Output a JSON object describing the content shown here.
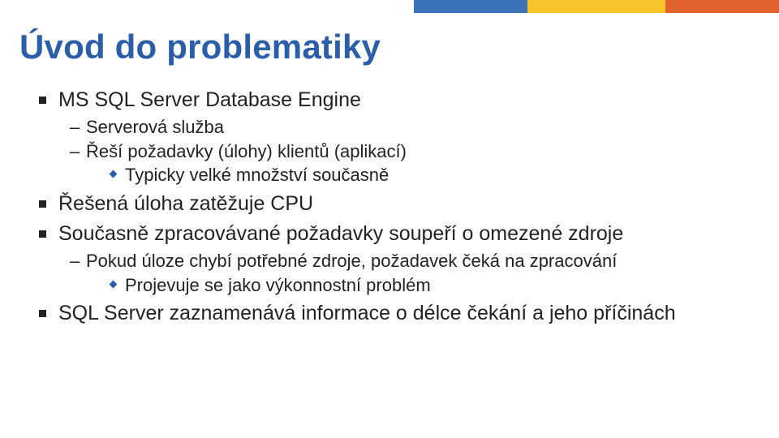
{
  "colors": {
    "title": "#2a5ea8",
    "stripe_blue": "#3b72b8",
    "stripe_yellow": "#f7c52a",
    "stripe_orange": "#e0622f"
  },
  "title": "Úvod do problematiky",
  "bullets": {
    "b1": "MS SQL Server Database Engine",
    "b1_1": "Serverová služba",
    "b1_2": "Řeší požadavky (úlohy) klientů (aplikací)",
    "b1_2_1": "Typicky velké množství současně",
    "b2": "Řešená úloha zatěžuje CPU",
    "b3": "Současně zpracovávané požadavky soupeří o omezené zdroje",
    "b3_1": "Pokud úloze chybí potřebné zdroje, požadavek čeká na zpracování",
    "b3_1_1": "Projevuje se jako výkonnostní problém",
    "b4": "SQL Server zaznamenává informace o délce čekání a jeho příčinách"
  }
}
